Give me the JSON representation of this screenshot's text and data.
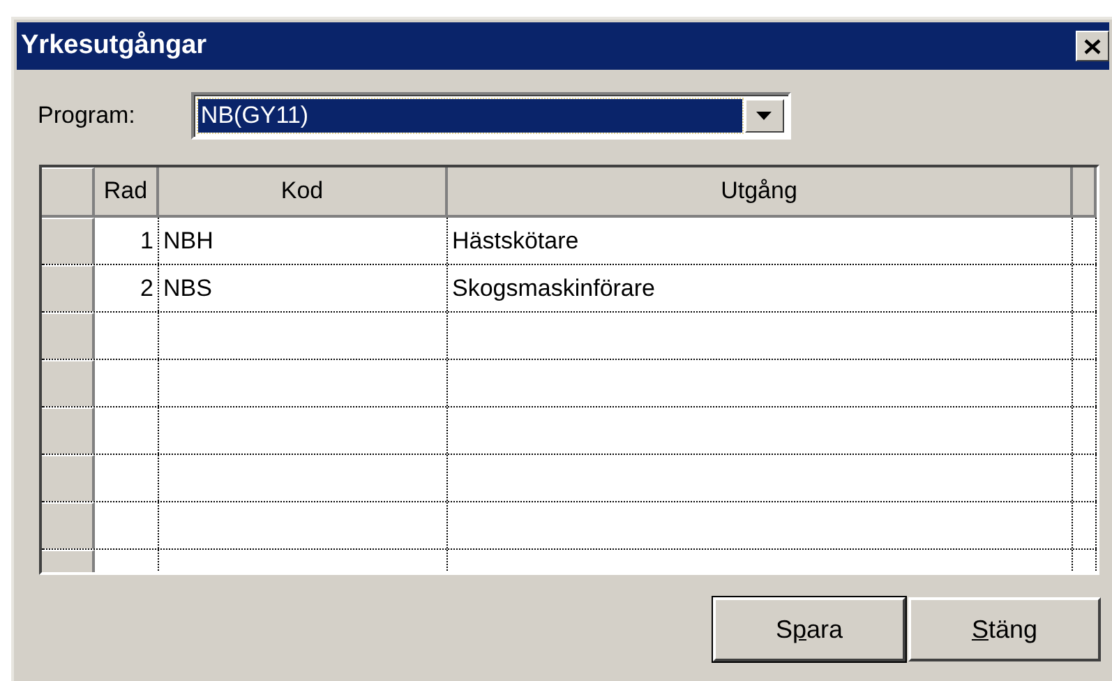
{
  "window": {
    "title": "Yrkesutgångar"
  },
  "program": {
    "label": "Program:",
    "value": "NB(GY11)",
    "focused": true
  },
  "table": {
    "columns": [
      "Rad",
      "Kod",
      "Utgång"
    ],
    "rows": [
      {
        "cells": [
          "1",
          "NBH",
          "Hästskötare"
        ]
      },
      {
        "cells": [
          "2",
          "NBS",
          "Skogsmaskinförare"
        ]
      }
    ]
  },
  "buttons": [
    {
      "label_start": "S",
      "mnemonic": "p",
      "label_end": "ara",
      "default": true
    },
    {
      "mnemonic": "S",
      "label_end": "täng",
      "default": false
    }
  ]
}
